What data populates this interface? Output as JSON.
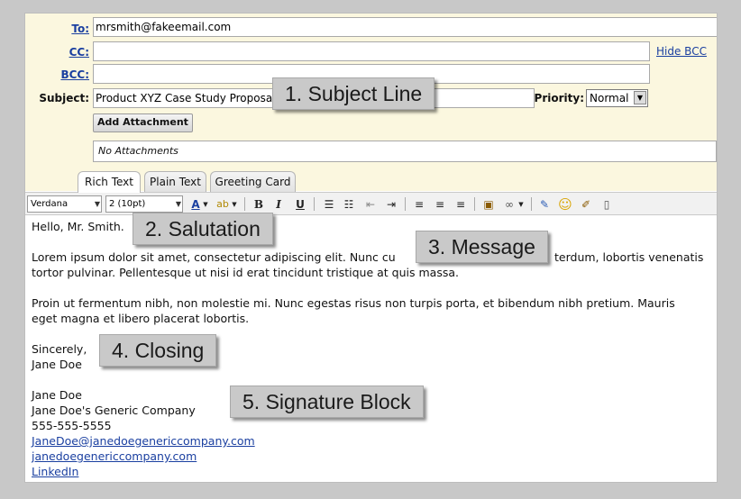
{
  "compose": {
    "to_label": "To:",
    "to_value": "mrsmith@fakeemail.com",
    "cc_label": "CC:",
    "bcc_label": "BCC:",
    "hide_bcc": "Hide BCC",
    "subject_label": "Subject:",
    "subject_value": "Product XYZ Case Study Proposal",
    "priority_label": "Priority:",
    "priority_value": "Normal",
    "add_attachment": "Add Attachment",
    "attachments_text": "No Attachments"
  },
  "tabs": [
    "Rich Text",
    "Plain Text",
    "Greeting Card"
  ],
  "toolbar": {
    "font": "Verdana",
    "size": "2 (10pt)",
    "bold": "B",
    "italic": "I",
    "underline": "U"
  },
  "message": {
    "salutation": "Hello, Mr. Smith.",
    "paragraph1": "Lorem ipsum dolor sit amet, consectetur adipiscing elit. Nunc cu",
    "paragraph1_tail": "terdum, lobortis venenatis",
    "paragraph1_line2": "tortor pulvinar. Pellentesque ut nisi id erat tincidunt tristique at quis massa.",
    "paragraph2_line1": "Proin ut fermentum nibh, non molestie mi. Nunc egestas risus non turpis porta, et bibendum nibh pretium. Mauris",
    "paragraph2_line2": "eget magna et libero placerat lobortis.",
    "closing": "Sincerely,",
    "closing_name": "Jane Doe",
    "sig_name": "Jane Doe",
    "sig_company": "Jane Doe's Generic Company",
    "sig_phone": "555-555-5555",
    "sig_email": "JaneDoe@janedoegenericcompany.com",
    "sig_website": "janedoegenericcompany.com",
    "sig_linkedin": "LinkedIn"
  },
  "callouts": {
    "subject_line": "1. Subject Line",
    "salutation": "2. Salutation",
    "message": "3. Message",
    "closing": "4. Closing",
    "signature_block": "5. Signature Block"
  },
  "icons": [
    "text-color-icon",
    "highlight-icon",
    "numbered-list-icon",
    "bullet-list-icon",
    "outdent-icon",
    "indent-icon",
    "align-left-icon",
    "align-center-icon",
    "align-right-icon",
    "paste-icon",
    "link-icon",
    "spellcheck-icon",
    "smiley-icon",
    "stationery-icon",
    "new-page-icon"
  ]
}
